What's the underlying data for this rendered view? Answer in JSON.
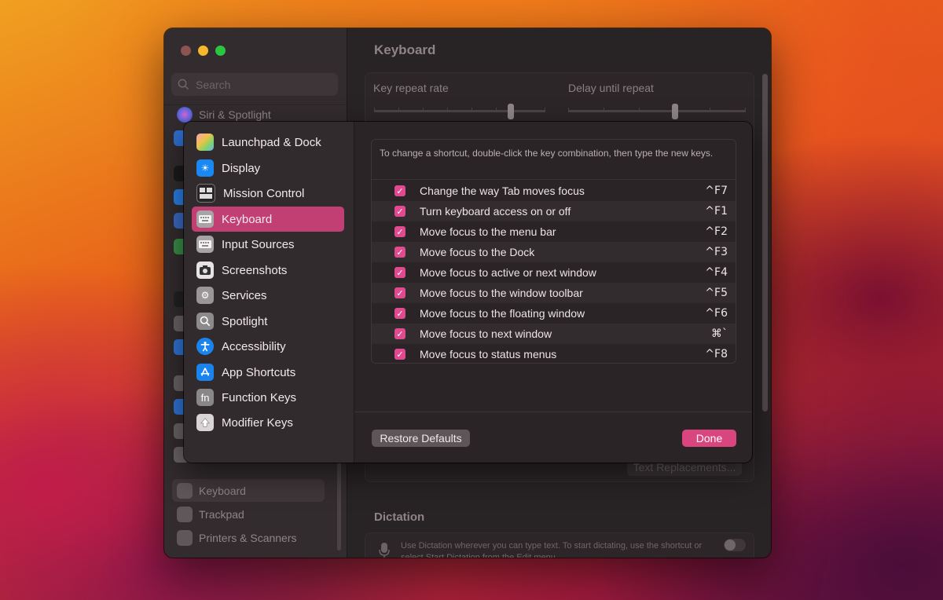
{
  "window": {
    "title": "Keyboard",
    "search_placeholder": "Search",
    "sidebar_top_item": "Siri & Spotlight",
    "sidebar_bottom_items": [
      "Keyboard",
      "Trackpad",
      "Printers & Scanners"
    ],
    "key_repeat_label": "Key repeat rate",
    "delay_label": "Delay until repeat",
    "key_repeat_level": 0.8,
    "delay_level": 0.6,
    "text_replacements_label": "Text Replacements...",
    "dictation_title": "Dictation",
    "dictation_text": "Use Dictation wherever you can type text. To start dictating, use the shortcut or select Start Dictation from the Edit menu."
  },
  "sheet": {
    "categories": [
      {
        "label": "Launchpad & Dock",
        "icon": "launchpad-icon"
      },
      {
        "label": "Display",
        "icon": "display-brightness-icon"
      },
      {
        "label": "Mission Control",
        "icon": "mission-control-icon"
      },
      {
        "label": "Keyboard",
        "icon": "keyboard-icon"
      },
      {
        "label": "Input Sources",
        "icon": "keyboard-icon"
      },
      {
        "label": "Screenshots",
        "icon": "camera-icon"
      },
      {
        "label": "Services",
        "icon": "gears-icon"
      },
      {
        "label": "Spotlight",
        "icon": "magnifier-icon"
      },
      {
        "label": "Accessibility",
        "icon": "accessibility-icon"
      },
      {
        "label": "App Shortcuts",
        "icon": "app-store-icon"
      },
      {
        "label": "Function Keys",
        "icon": "fn-key-icon"
      },
      {
        "label": "Modifier Keys",
        "icon": "up-arrow-icon"
      }
    ],
    "selected_category": "Keyboard",
    "hint": "To change a shortcut, double-click the key combination, then type the new keys.",
    "shortcuts": [
      {
        "label": "Change the way Tab moves focus",
        "key": "^F7",
        "checked": true
      },
      {
        "label": "Turn keyboard access on or off",
        "key": "^F1",
        "checked": true
      },
      {
        "label": "Move focus to the menu bar",
        "key": "^F2",
        "checked": true
      },
      {
        "label": "Move focus to the Dock",
        "key": "^F3",
        "checked": true
      },
      {
        "label": "Move focus to active or next window",
        "key": "^F4",
        "checked": true
      },
      {
        "label": "Move focus to the window toolbar",
        "key": "^F5",
        "checked": true
      },
      {
        "label": "Move focus to the floating window",
        "key": "^F6",
        "checked": true
      },
      {
        "label": "Move focus to next window",
        "key": "⌘`",
        "checked": true
      },
      {
        "label": "Move focus to status menus",
        "key": "^F8",
        "checked": true
      }
    ],
    "restore_label": "Restore Defaults",
    "done_label": "Done"
  },
  "colors": {
    "accent": "#d9457f",
    "selected_row": "#c23f74",
    "checkbox": "#e04a8e"
  }
}
